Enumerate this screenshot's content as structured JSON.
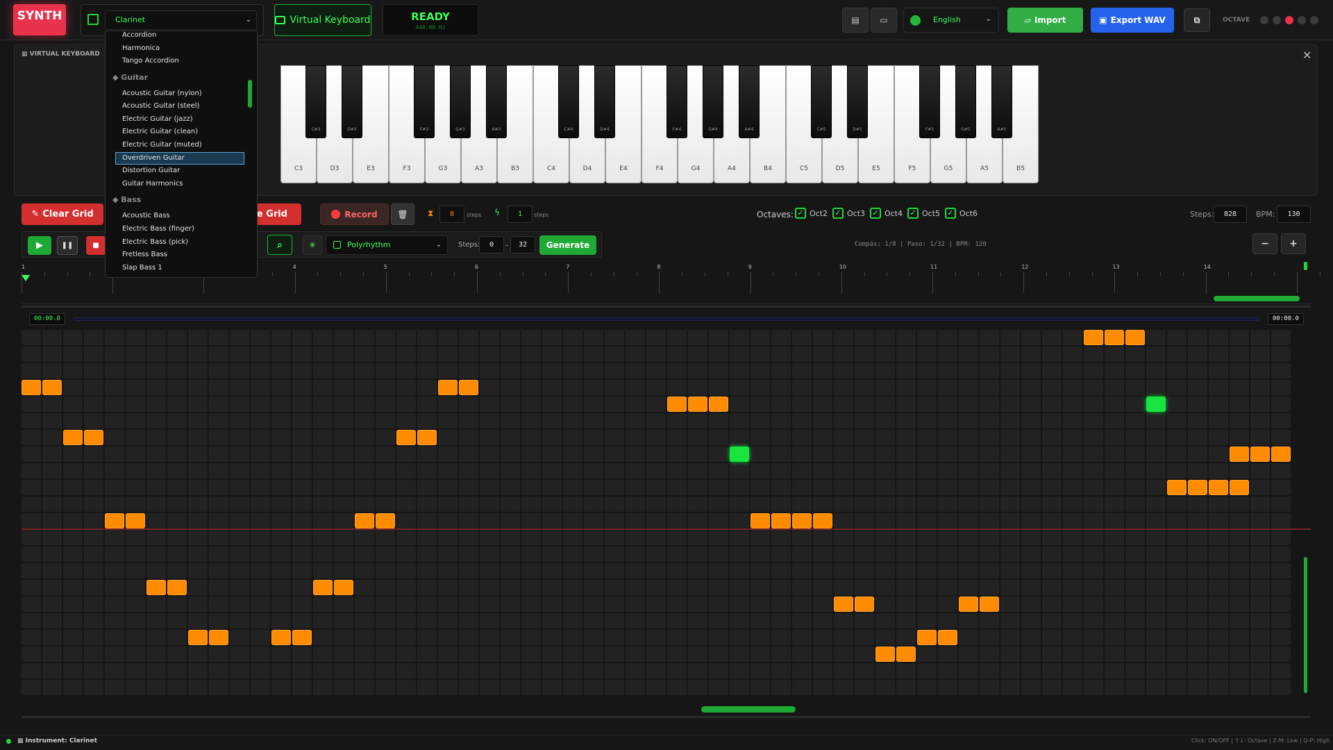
{
  "app": {
    "logo": "SYNTH"
  },
  "instrument": {
    "selected": "Clarinet"
  },
  "dropdown": {
    "top_items": [
      "Accordion",
      "Harmonica",
      "Tango Accordion"
    ],
    "categories": [
      {
        "name": "Guitar",
        "items": [
          "Acoustic Guitar (nylon)",
          "Acoustic Guitar (steel)",
          "Electric Guitar (jazz)",
          "Electric Guitar (clean)",
          "Electric Guitar (muted)",
          "Overdriven Guitar",
          "Distortion Guitar",
          "Guitar Harmonics"
        ]
      },
      {
        "name": "Bass",
        "items": [
          "Acoustic Bass",
          "Electric Bass (finger)",
          "Electric Bass (pick)",
          "Fretless Bass",
          "Slap Bass 1"
        ]
      }
    ],
    "highlighted": "Overdriven Guitar"
  },
  "toolbar": {
    "virtual_keyboard": "Virtual Keyboard",
    "ready": "READY",
    "frequency": "440.00 Hz",
    "language": "English",
    "import": "Import",
    "export": "Export WAV",
    "octave_label": "OCTAVE"
  },
  "keyboard": {
    "title": "VIRTUAL KEYBOARD",
    "white_keys": [
      "C3",
      "D3",
      "E3",
      "F3",
      "G3",
      "A3",
      "B3",
      "C4",
      "D4",
      "E4",
      "F4",
      "G4",
      "A4",
      "B4",
      "C5",
      "D5",
      "E5",
      "F5",
      "G5",
      "A5",
      "B5"
    ],
    "black_keys": [
      {
        "label": "C#3",
        "after": 0
      },
      {
        "label": "D#3",
        "after": 1
      },
      {
        "label": "F#3",
        "after": 3
      },
      {
        "label": "G#3",
        "after": 4
      },
      {
        "label": "A#3",
        "after": 5
      },
      {
        "label": "C#4",
        "after": 7
      },
      {
        "label": "D#4",
        "after": 8
      },
      {
        "label": "F#4",
        "after": 10
      },
      {
        "label": "G#4",
        "after": 11
      },
      {
        "label": "A#4",
        "after": 12
      },
      {
        "label": "C#5",
        "after": 14
      },
      {
        "label": "D#5",
        "after": 15
      },
      {
        "label": "F#5",
        "after": 17
      },
      {
        "label": "G#5",
        "after": 18
      },
      {
        "label": "A#5",
        "after": 19
      }
    ]
  },
  "controls": {
    "clear_grid": "Clear Grid",
    "rotate_grid_partial": "ate Grid",
    "record": "Record",
    "steps_value": "8",
    "steps_unit": "steps",
    "steps2_value": "1",
    "steps2_unit": "steps",
    "octaves_label": "Octaves:",
    "octaves": [
      "Oct2",
      "Oct3",
      "Oct4",
      "Oct5",
      "Oct6"
    ],
    "steps_label": "Steps:",
    "steps_total": "828",
    "bpm_label": "BPM:",
    "bpm": "130"
  },
  "transport": {
    "pattern": "Polyrhythm",
    "steps_label": "Steps:",
    "steps_from": "0",
    "steps_to": "32",
    "generate": "Generate",
    "status": "Compás: 1/8 | Paso: 1/32 | BPM: 120",
    "zoom_out": "−",
    "zoom_in": "+"
  },
  "timeline": {
    "markers": [
      "1",
      "2",
      "3",
      "4",
      "5",
      "6",
      "7",
      "8",
      "9",
      "10",
      "11",
      "12",
      "13",
      "14"
    ],
    "time_start": "00:00.0",
    "time_end": "00:00.0"
  },
  "grid": {
    "cols": 61,
    "rows": 22,
    "notes": [
      {
        "r": 0,
        "c": 51
      },
      {
        "r": 0,
        "c": 52
      },
      {
        "r": 0,
        "c": 53
      },
      {
        "r": 3,
        "c": 0
      },
      {
        "r": 3,
        "c": 1
      },
      {
        "r": 3,
        "c": 20
      },
      {
        "r": 3,
        "c": 21
      },
      {
        "r": 4,
        "c": 31
      },
      {
        "r": 4,
        "c": 32
      },
      {
        "r": 4,
        "c": 33
      },
      {
        "r": 4,
        "c": 54,
        "g": true
      },
      {
        "r": 6,
        "c": 2
      },
      {
        "r": 6,
        "c": 3
      },
      {
        "r": 6,
        "c": 18
      },
      {
        "r": 6,
        "c": 19
      },
      {
        "r": 7,
        "c": 34,
        "g": true
      },
      {
        "r": 7,
        "c": 58
      },
      {
        "r": 7,
        "c": 59
      },
      {
        "r": 7,
        "c": 60
      },
      {
        "r": 9,
        "c": 55
      },
      {
        "r": 9,
        "c": 56
      },
      {
        "r": 9,
        "c": 57
      },
      {
        "r": 9,
        "c": 58
      },
      {
        "r": 11,
        "c": 4
      },
      {
        "r": 11,
        "c": 5
      },
      {
        "r": 11,
        "c": 16
      },
      {
        "r": 11,
        "c": 17
      },
      {
        "r": 11,
        "c": 35
      },
      {
        "r": 11,
        "c": 36
      },
      {
        "r": 11,
        "c": 37
      },
      {
        "r": 11,
        "c": 38
      },
      {
        "r": 15,
        "c": 6
      },
      {
        "r": 15,
        "c": 7
      },
      {
        "r": 15,
        "c": 14
      },
      {
        "r": 15,
        "c": 15
      },
      {
        "r": 16,
        "c": 39
      },
      {
        "r": 16,
        "c": 40
      },
      {
        "r": 16,
        "c": 45
      },
      {
        "r": 16,
        "c": 46
      },
      {
        "r": 18,
        "c": 8
      },
      {
        "r": 18,
        "c": 9
      },
      {
        "r": 18,
        "c": 12
      },
      {
        "r": 18,
        "c": 13
      },
      {
        "r": 18,
        "c": 43
      },
      {
        "r": 18,
        "c": 44
      },
      {
        "r": 19,
        "c": 41
      },
      {
        "r": 19,
        "c": 42
      }
    ]
  },
  "footer": {
    "instrument": "Instrument: Clarinet",
    "hint": "Click: ON/OFF | ↑↓: Octave | Z-M: Low | Q-P: High"
  },
  "colors": {
    "accent": "#3cff5a",
    "note": "#ff8c00",
    "danger": "#d32f2f",
    "primary": "#2563eb"
  }
}
